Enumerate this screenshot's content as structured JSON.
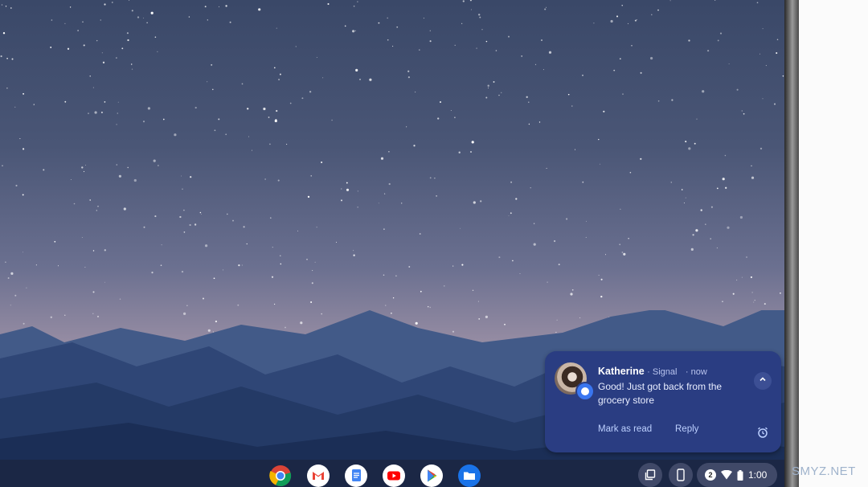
{
  "notification": {
    "sender": "Katherine",
    "app_meta": "· Signal",
    "time": "· now",
    "message": "Good! Just got back from the grocery store",
    "actions": {
      "mark_as_read": "Mark as read",
      "reply": "Reply"
    },
    "collapse_icon": "chevron-up-icon",
    "snooze_icon": "alarm-clock-icon",
    "accent": "#2a3d82"
  },
  "shelf": {
    "apps": [
      {
        "name": "chrome-app-icon"
      },
      {
        "name": "gmail-app-icon"
      },
      {
        "name": "docs-app-icon"
      },
      {
        "name": "youtube-app-icon"
      },
      {
        "name": "play-store-app-icon"
      },
      {
        "name": "files-app-icon"
      }
    ],
    "tray": {
      "notification_count": "2",
      "time": "1:00"
    }
  },
  "watermark": "SMYZ.NET"
}
